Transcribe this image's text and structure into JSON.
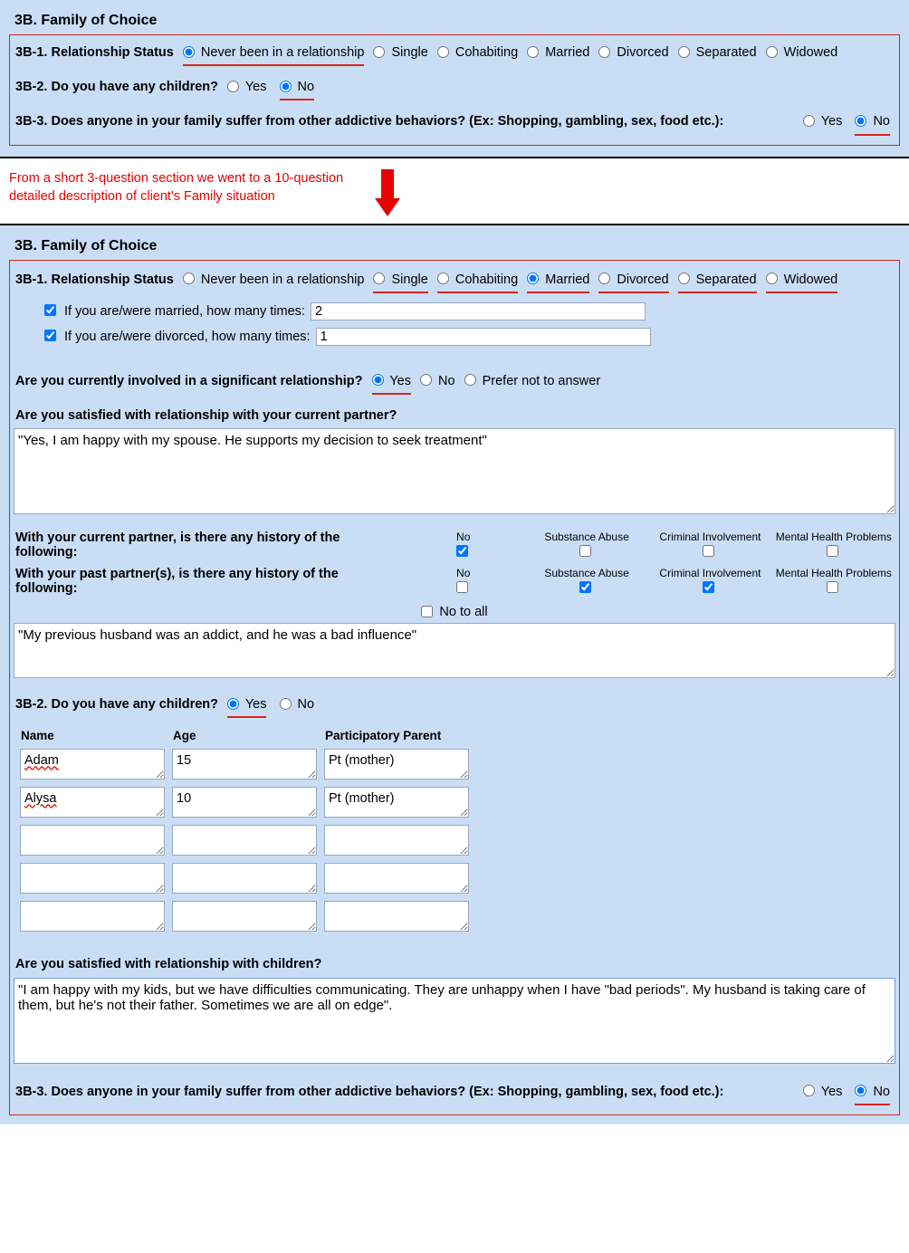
{
  "section_title": "3B. Family of Choice",
  "q3b1": {
    "label": "3B-1. Relationship Status",
    "options": [
      "Never been in a relationship",
      "Single",
      "Cohabiting",
      "Married",
      "Divorced",
      "Separated",
      "Widowed"
    ],
    "selected_top": "Never been in a relationship",
    "selected_bottom": "Married"
  },
  "q3b2": {
    "label": "3B-2. Do you have any children?",
    "yes": "Yes",
    "no": "No",
    "selected_top": "No",
    "selected_bottom": "Yes"
  },
  "q3b3": {
    "label": "3B-3. Does anyone in your family suffer from other addictive behaviors? (Ex: Shopping, gambling, sex, food etc.):",
    "yes": "Yes",
    "no": "No",
    "selected_top": "No",
    "selected_bottom": "No"
  },
  "annotation": "From a short 3-question section we went to a 10-question detailed description of client's Family situation",
  "married_q": {
    "label": "If you are/were married, how many times:",
    "value": "2",
    "checked": true
  },
  "divorced_q": {
    "label": "If you are/were divorced, how many times:",
    "value": "1",
    "checked": true
  },
  "sig_rel": {
    "label": "Are you currently involved in a significant relationship?",
    "options": [
      "Yes",
      "No",
      "Prefer not to answer"
    ],
    "selected": "Yes"
  },
  "satisfied_partner": {
    "label": "Are you satisfied with relationship with your current partner?",
    "value": "\"Yes, I am happy with my spouse. He supports my decision to seek treatment\""
  },
  "hist_cols": [
    "No",
    "Substance Abuse",
    "Criminal Involvement",
    "Mental Health Problems"
  ],
  "hist_current": {
    "label": "With your current partner, is there any history of the following:",
    "checks": [
      true,
      false,
      false,
      false
    ]
  },
  "hist_past": {
    "label": "With your past partner(s), is there any history of the following:",
    "checks": [
      false,
      true,
      true,
      false
    ]
  },
  "no_to_all": {
    "label": "No to all",
    "checked": false
  },
  "past_partner_text": "\"My previous husband was an addict, and he was a bad influence\"",
  "children": {
    "headers": [
      "Name",
      "Age",
      "Participatory Parent"
    ],
    "rows": [
      {
        "name": "Adam",
        "age": "15",
        "pp": "Pt (mother)"
      },
      {
        "name": "Alysa",
        "age": "10",
        "pp": "Pt (mother)"
      },
      {
        "name": "",
        "age": "",
        "pp": ""
      },
      {
        "name": "",
        "age": "",
        "pp": ""
      },
      {
        "name": "",
        "age": "",
        "pp": ""
      }
    ]
  },
  "satisfied_children": {
    "label": "Are you satisfied with relationship with children?",
    "value": "\"I am happy with my kids, but we have difficulties communicating. They are unhappy when I have \"bad periods\". My husband is taking care of them, but he's not their father. Sometimes we are all on edge\"."
  }
}
